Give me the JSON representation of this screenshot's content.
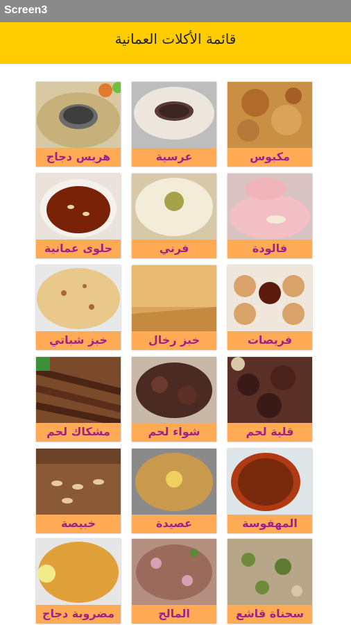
{
  "window": {
    "title": "Screen3"
  },
  "header": {
    "title": "قائمة الأكلات العمانية"
  },
  "menu": [
    {
      "label": "هريس دجاج",
      "icon": "harees-chicken-photo"
    },
    {
      "label": "عرسية",
      "icon": "arsiya-photo"
    },
    {
      "label": "مكبوس",
      "icon": "makboos-photo"
    },
    {
      "label": "حلوى عمانية",
      "icon": "omani-halwa-photo"
    },
    {
      "label": "فرني",
      "icon": "firni-photo"
    },
    {
      "label": "فالودة",
      "icon": "faloodah-photo"
    },
    {
      "label": "خبز شباتي",
      "icon": "chapati-bread-photo"
    },
    {
      "label": "خبز رخال",
      "icon": "rakhal-bread-photo"
    },
    {
      "label": "فريصات",
      "icon": "furaisat-photo"
    },
    {
      "label": "مشكاك لحم",
      "icon": "meat-skewers-photo"
    },
    {
      "label": "شواء لحم",
      "icon": "shuwa-meat-photo"
    },
    {
      "label": "قلية لحم",
      "icon": "fried-meat-photo"
    },
    {
      "label": "خبيصة",
      "icon": "khabisa-photo"
    },
    {
      "label": "عصيدة",
      "icon": "aseeda-photo"
    },
    {
      "label": "المهفوسة",
      "icon": "mahfousa-photo"
    },
    {
      "label": "مضروبة دجاج",
      "icon": "madrouba-chicken-photo"
    },
    {
      "label": "المالح",
      "icon": "salted-fish-photo"
    },
    {
      "label": "سحناة قاشع",
      "icon": "sahnah-qashea-photo"
    }
  ],
  "colors": {
    "header": "#ffcc00",
    "caption_bg": "#ffaa55",
    "caption_text": "#a0208a",
    "titlebar": "#8a8a8a"
  }
}
